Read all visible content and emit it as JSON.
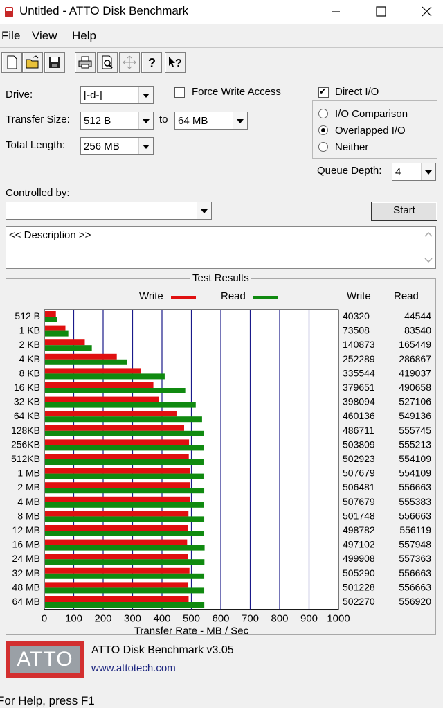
{
  "window": {
    "title": "Untitled - ATTO Disk Benchmark"
  },
  "menu": [
    "File",
    "View",
    "Help"
  ],
  "toolbar_icons": [
    "new-file-icon",
    "open-folder-icon",
    "save-icon",
    "print-icon",
    "print-preview-icon",
    "move-icon",
    "help-icon",
    "context-help-icon"
  ],
  "form": {
    "drive_label": "Drive:",
    "drive_value": "[-d-]",
    "force_write_label": "Force Write Access",
    "direct_io_label": "Direct I/O",
    "transfer_size_label": "Transfer Size:",
    "transfer_from": "512 B",
    "to_label": "to",
    "transfer_to": "64 MB",
    "total_length_label": "Total Length:",
    "total_length_value": "256 MB",
    "io_comparison": "I/O Comparison",
    "overlapped_io": "Overlapped I/O",
    "neither": "Neither",
    "queue_depth_label": "Queue Depth:",
    "queue_depth_value": "4",
    "controlled_by_label": "Controlled by:",
    "controlled_by_value": "",
    "start_label": "Start",
    "description": "<< Description >>"
  },
  "results": {
    "group_title": "Test Results",
    "write_legend": "Write",
    "read_legend": "Read",
    "write_col": "Write",
    "read_col": "Read"
  },
  "colors": {
    "write": "#e01010",
    "read": "#108a10",
    "grid": "#1a1a8a"
  },
  "chart_data": {
    "type": "bar",
    "orientation": "horizontal",
    "categories": [
      "512 B",
      "1 KB",
      "2 KB",
      "4 KB",
      "8 KB",
      "16 KB",
      "32 KB",
      "64 KB",
      "128KB",
      "256KB",
      "512KB",
      "1 MB",
      "2 MB",
      "4 MB",
      "8 MB",
      "12 MB",
      "16 MB",
      "24 MB",
      "32 MB",
      "48 MB",
      "64 MB"
    ],
    "series": [
      {
        "name": "Write",
        "values": [
          40320,
          73508,
          140873,
          252289,
          335544,
          379651,
          398094,
          460136,
          486711,
          503809,
          502923,
          507679,
          506481,
          507679,
          501748,
          498782,
          497102,
          499908,
          505290,
          501228,
          502270
        ]
      },
      {
        "name": "Read",
        "values": [
          44544,
          83540,
          165449,
          286867,
          419037,
          490658,
          527106,
          549136,
          555745,
          555213,
          554109,
          554109,
          556663,
          555383,
          556663,
          556119,
          557948,
          557363,
          556663,
          556663,
          556920
        ]
      }
    ],
    "xlabel": "Transfer Rate - MB / Sec",
    "xlim": [
      0,
      1000
    ],
    "xticks": [
      "0",
      "100",
      "200",
      "300",
      "400",
      "500",
      "600",
      "700",
      "800",
      "900",
      "1000"
    ],
    "grid": true,
    "legend": "top"
  },
  "footer": {
    "logo_text": "ATTO",
    "product": "ATTO Disk Benchmark v3.05",
    "url": "www.attotech.com"
  },
  "status": "For Help, press F1"
}
